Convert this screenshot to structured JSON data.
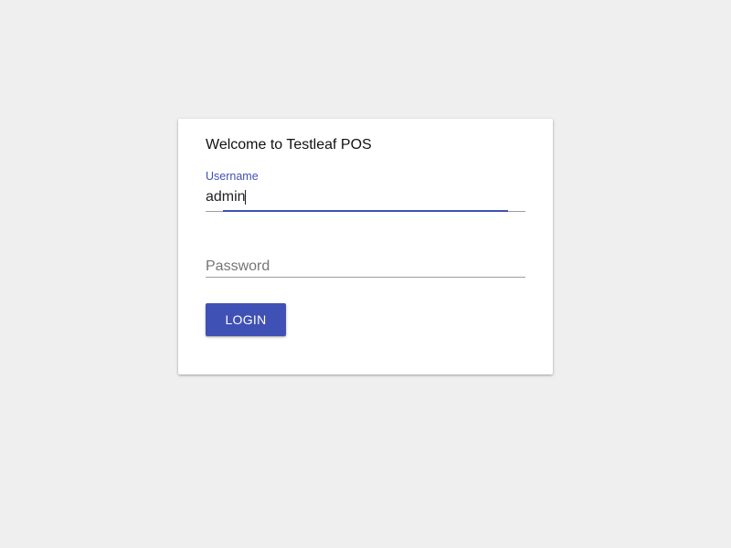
{
  "colors": {
    "page_background": "#efefef",
    "card_background": "#ffffff",
    "accent": "#3f51b5",
    "button_background": "#3f51b5",
    "underline": "#9e9e9e",
    "placeholder": "#757575"
  },
  "login_card": {
    "title": "Welcome to Testleaf POS",
    "username": {
      "label": "Username",
      "value": "admin",
      "focused": true
    },
    "password": {
      "placeholder": "Password",
      "value": ""
    },
    "login_button": "LOGIN"
  }
}
